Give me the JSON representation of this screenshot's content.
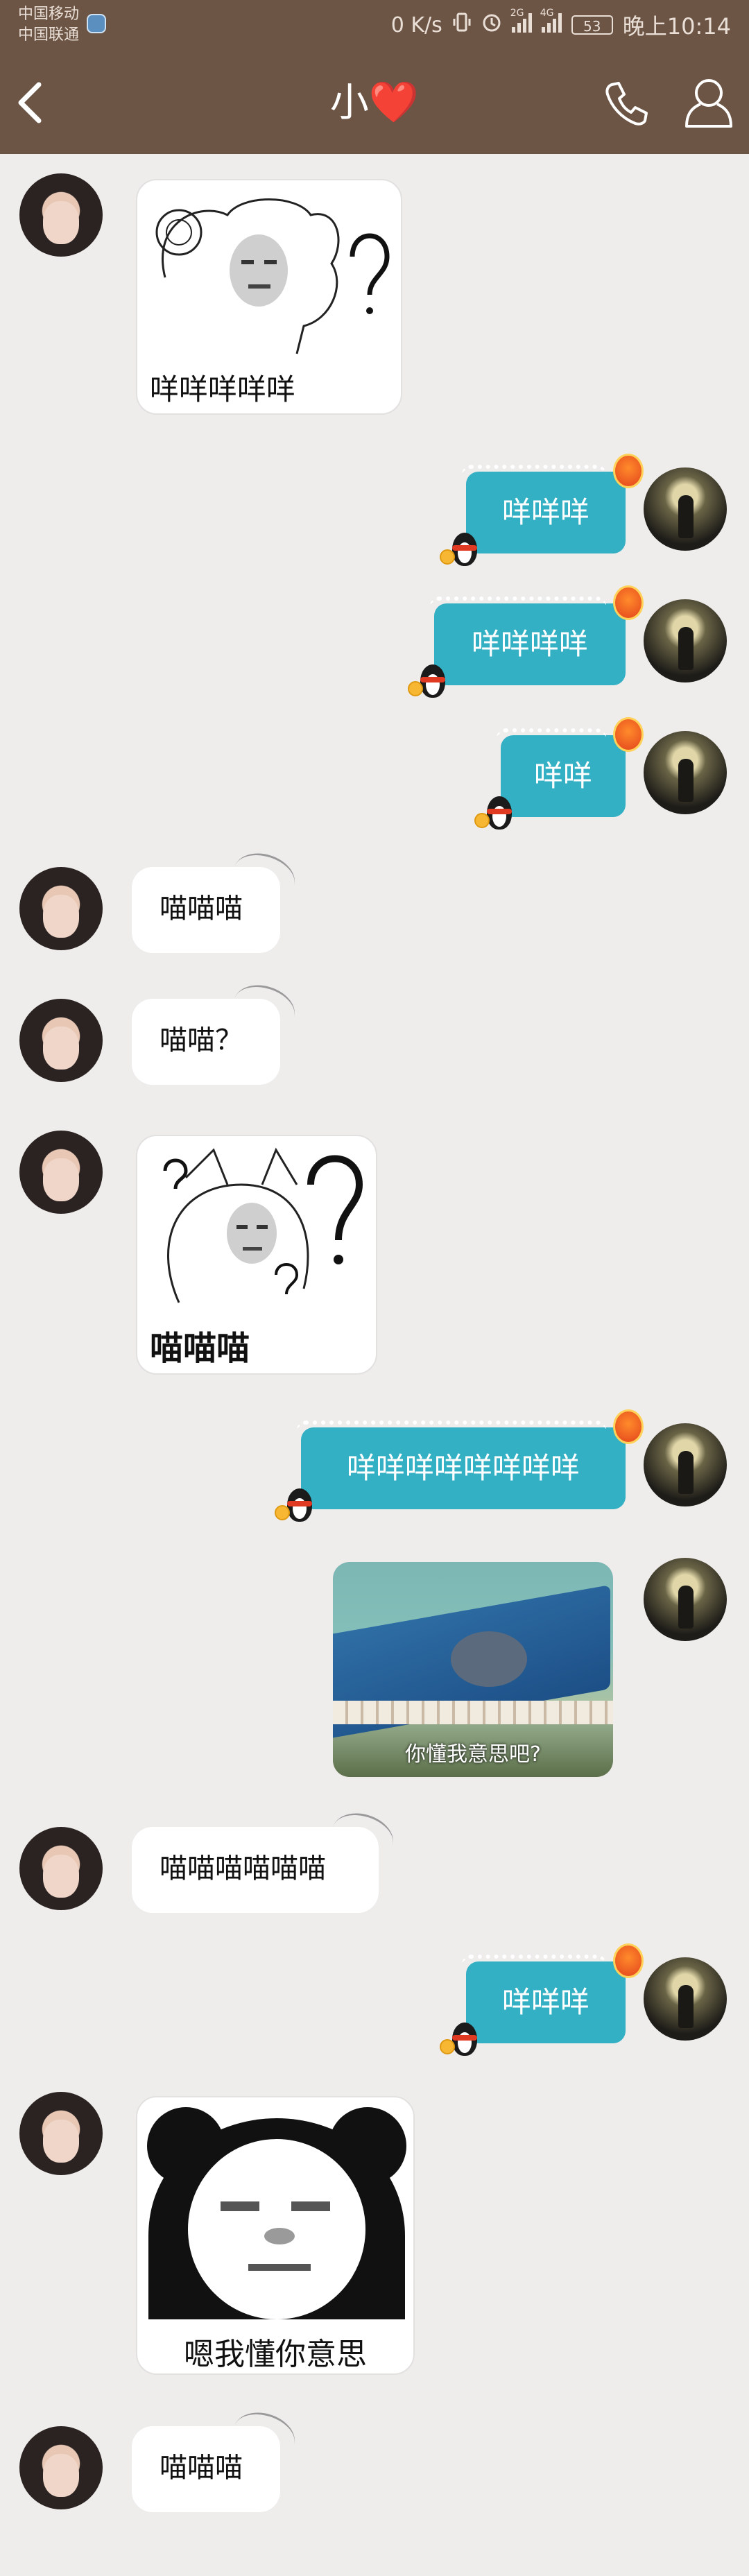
{
  "status_bar": {
    "carrier_1": "中国移动",
    "carrier_2": "中国联通",
    "net_speed": "0 K/s",
    "net_2g": "2G",
    "net_4g": "4G",
    "battery": "53",
    "time": "晚上10:14"
  },
  "header": {
    "title": "小",
    "title_emoji": "❤️",
    "back_icon": "chevron-left-icon",
    "call_icon": "phone-icon",
    "profile_icon": "person-icon"
  },
  "messages": [
    {
      "side": "left",
      "type": "sticker",
      "caption": "咩咩咩咩咩"
    },
    {
      "side": "right",
      "type": "text",
      "text": "咩咩咩"
    },
    {
      "side": "right",
      "type": "text",
      "text": "咩咩咩咩"
    },
    {
      "side": "right",
      "type": "text",
      "text": "咩咩"
    },
    {
      "side": "left",
      "type": "text",
      "text": "喵喵喵"
    },
    {
      "side": "left",
      "type": "text",
      "text": "喵喵？"
    },
    {
      "side": "left",
      "type": "sticker",
      "caption": "喵喵喵"
    },
    {
      "side": "right",
      "type": "text",
      "text": "咩咩咩咩咩咩咩咩"
    },
    {
      "side": "right",
      "type": "image",
      "caption": "你懂我意思吧?"
    },
    {
      "side": "left",
      "type": "text",
      "text": "喵喵喵喵喵喵"
    },
    {
      "side": "right",
      "type": "text",
      "text": "咩咩咩"
    },
    {
      "side": "left",
      "type": "sticker",
      "caption": "嗯我懂你意思"
    },
    {
      "side": "left",
      "type": "text",
      "text": "喵喵喵"
    }
  ],
  "colors": {
    "header_bg": "#6d5545",
    "page_bg": "#efecec",
    "right_bubble": "#33b0c4"
  }
}
